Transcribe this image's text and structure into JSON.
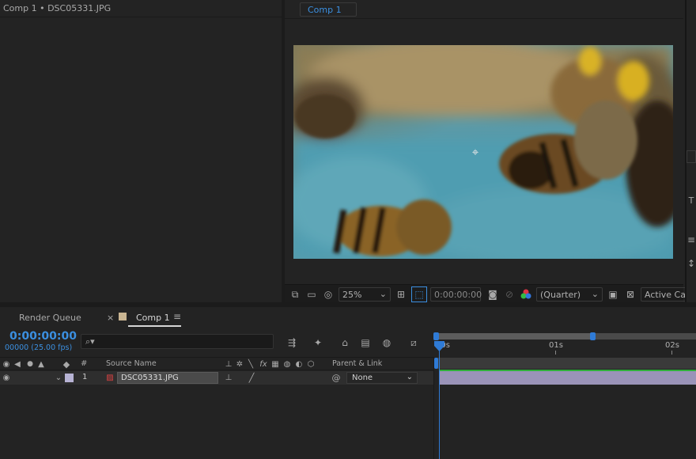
{
  "project_panel": {
    "title": "Comp 1 • DSC05331.JPG"
  },
  "viewer": {
    "tab_label": "Comp 1",
    "zoom": "25%",
    "timecode": "0:00:00:00",
    "resolution": "(Quarter)",
    "camera": "Active Ca"
  },
  "timeline": {
    "tabs": {
      "render_queue": "Render Queue",
      "close": "×",
      "comp": "Comp 1",
      "menu": "≡"
    },
    "timecode": "0:00:00:00",
    "frames": "00000 (25.00 fps)",
    "search_icon": "⌕▾",
    "ruler": {
      "t0": "00s",
      "t1": "01s",
      "t2": "02s"
    },
    "columns": {
      "number": "#",
      "source_name": "Source Name",
      "parent_link": "Parent & Link"
    },
    "layer": {
      "number": "1",
      "name": "DSC05331.JPG",
      "parent": "None"
    }
  },
  "colors": {
    "accent": "#3b8fe0",
    "label_tan": "#c9b592",
    "layer_bar": "#9a93b8",
    "cti": "#2f7bd6"
  },
  "icons": [
    "eye-icon",
    "audio-icon",
    "solo-icon",
    "lock-icon",
    "label-icon",
    "search-icon",
    "camera-icon",
    "chevron-down-icon"
  ]
}
